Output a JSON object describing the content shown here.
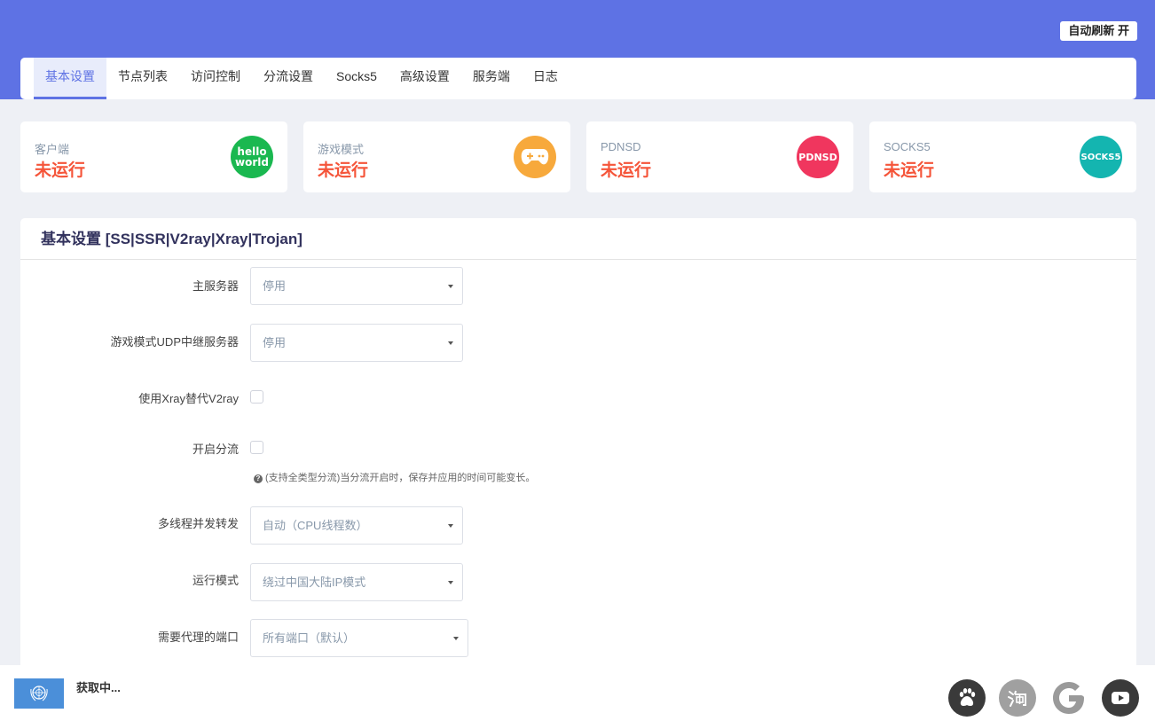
{
  "header": {
    "auto_refresh_label": "自动刷新 开"
  },
  "tabs": [
    {
      "label": "基本设置"
    },
    {
      "label": "节点列表"
    },
    {
      "label": "访问控制"
    },
    {
      "label": "分流设置"
    },
    {
      "label": "Socks5"
    },
    {
      "label": "高级设置"
    },
    {
      "label": "服务端"
    },
    {
      "label": "日志"
    }
  ],
  "status_cards": [
    {
      "label": "客户端",
      "status": "未运行",
      "icon_text_1": "hello",
      "icon_text_2": "world",
      "icon": "hello-world-icon",
      "color": "#1ab850"
    },
    {
      "label": "游戏模式",
      "status": "未运行",
      "icon": "gamepad-icon",
      "color": "#f7a93c"
    },
    {
      "label": "PDNSD",
      "status": "未运行",
      "icon_text_1": "PDNSD",
      "icon": "pdnsd-icon",
      "color": "#f0365e"
    },
    {
      "label": "SOCKS5",
      "status": "未运行",
      "icon_text_1": "SOCKS5",
      "icon": "socks5-icon",
      "color": "#14b5b0"
    }
  ],
  "panel": {
    "title": "基本设置 [SS|SSR|V2ray|Xray|Trojan]",
    "fields": {
      "main_server": {
        "label": "主服务器",
        "value": "停用"
      },
      "udp_relay": {
        "label": "游戏模式UDP中继服务器",
        "value": "停用"
      },
      "xray_replace": {
        "label": "使用Xray替代V2ray"
      },
      "shunt": {
        "label": "开启分流",
        "hint_icon": "?",
        "hint": "(支持全类型分流)当分流开启时，保存并应用的时间可能变长。"
      },
      "threads": {
        "label": "多线程并发转发",
        "value": "自动（CPU线程数）"
      },
      "run_mode": {
        "label": "运行模式",
        "value": "绕过中国大陆IP模式"
      },
      "proxy_ports": {
        "label": "需要代理的端口",
        "value": "所有端口（默认）"
      }
    }
  },
  "footer": {
    "status": "获取中...",
    "flag_icon": "un-flag-icon",
    "sites": [
      {
        "name": "baidu-icon",
        "color": "#3a3a3a"
      },
      {
        "name": "taobao-icon",
        "color": "#a0a0a0"
      },
      {
        "name": "google-icon",
        "color": "#9a9a9a"
      },
      {
        "name": "youtube-icon",
        "color": "#3a3a3a"
      }
    ]
  }
}
